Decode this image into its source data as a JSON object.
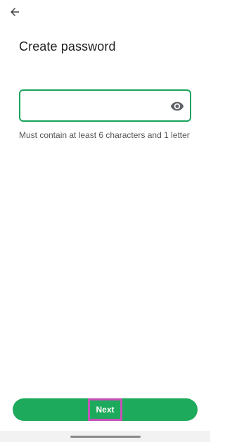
{
  "header": {
    "back_icon": "arrow-left-icon"
  },
  "page": {
    "title": "Create password"
  },
  "password": {
    "value": "",
    "placeholder": "",
    "toggle_icon": "eye-icon",
    "helper": "Must contain at least 6 characters and 1 letter"
  },
  "footer": {
    "next_label": "Next"
  },
  "colors": {
    "accent": "#1eaa5c",
    "highlight": "#c653b6",
    "text": "#1f1f1f",
    "muted": "#555555"
  }
}
